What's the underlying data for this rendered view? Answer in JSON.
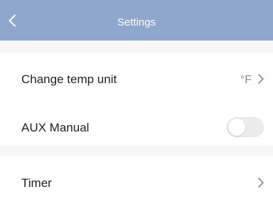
{
  "header": {
    "title": "Settings",
    "back_icon": "chevron-left-icon",
    "background": "#8fa6cd"
  },
  "settings": {
    "temp_unit": {
      "label": "Change temp unit",
      "value": "°F",
      "icon": "chevron-right-icon"
    },
    "aux_manual": {
      "label": "AUX Manual",
      "enabled": false
    },
    "timer": {
      "label": "Timer",
      "icon": "chevron-right-icon"
    }
  }
}
